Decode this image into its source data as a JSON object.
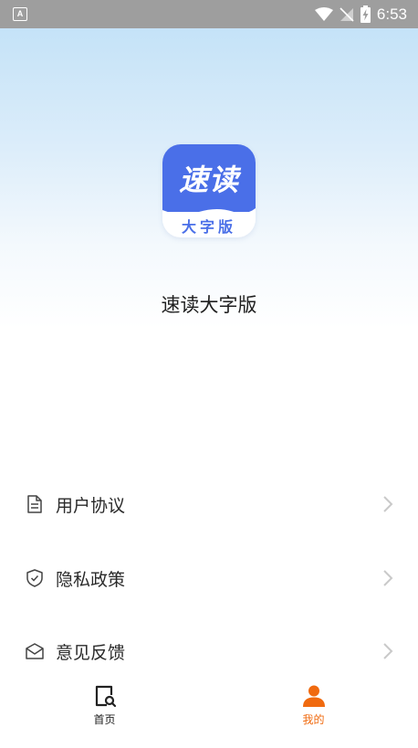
{
  "status_bar": {
    "time": "6:53",
    "left_icon": "A"
  },
  "app": {
    "logo_main": "速读",
    "logo_sub": "大字版",
    "name": "速读大字版",
    "accent_color": "#4a6fe8"
  },
  "menu": {
    "items": [
      {
        "label": "用户协议",
        "icon": "document-icon"
      },
      {
        "label": "隐私政策",
        "icon": "shield-check-icon"
      },
      {
        "label": "意见反馈",
        "icon": "envelope-icon"
      }
    ]
  },
  "bottom_nav": {
    "items": [
      {
        "label": "首页",
        "icon": "search-document-icon",
        "active": false
      },
      {
        "label": "我的",
        "icon": "user-icon",
        "active": true
      }
    ],
    "active_color": "#f06a0f"
  }
}
